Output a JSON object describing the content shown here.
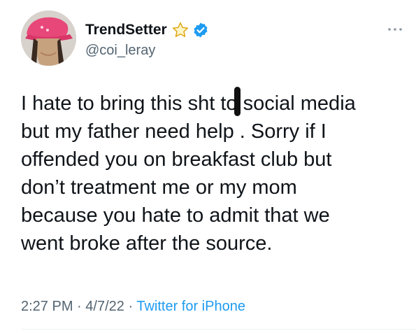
{
  "author": {
    "display_name": "TrendSetter",
    "handle": "@coi_leray",
    "badges": [
      "star-icon",
      "verified-icon"
    ],
    "avatar": "avatar-photo"
  },
  "tweet": {
    "lines": [
      "I hate to bring this sh",
      "t to social media",
      "but my father need help . Sorry if I",
      "offended you on breakfast club but",
      "don’t treatment me or my mom",
      "because you hate to admit that we",
      "went broke after the source."
    ]
  },
  "meta": {
    "time": "2:27 PM",
    "separator": "·",
    "date": "4/7/22",
    "source": "Twitter for iPhone"
  },
  "colors": {
    "text": "#0f1419",
    "secondary": "#536471",
    "link": "#1d9bf0",
    "verified": "#1d9bf0"
  }
}
